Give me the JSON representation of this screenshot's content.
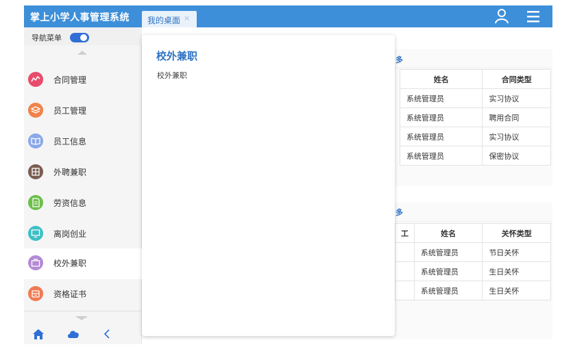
{
  "header": {
    "app_title": "掌上小学人事管理系统",
    "tab_label": "我的桌面",
    "tab_close": "×",
    "accent": "#3d8fd9"
  },
  "sidebar": {
    "toggle_label": "导航菜单",
    "toggle_on": true,
    "items": [
      {
        "label": "合同管理",
        "icon": "chart-line-icon",
        "color": "#e84c6a"
      },
      {
        "label": "员工管理",
        "icon": "layers-icon",
        "color": "#f0834b"
      },
      {
        "label": "员工信息",
        "icon": "book-icon",
        "color": "#8aa8e8"
      },
      {
        "label": "外聘兼职",
        "icon": "grid-icon",
        "color": "#7a5d52"
      },
      {
        "label": "劳资信息",
        "icon": "document-icon",
        "color": "#6cbf4a"
      },
      {
        "label": "离岗创业",
        "icon": "monitor-icon",
        "color": "#3cc0c6"
      },
      {
        "label": "校外兼职",
        "icon": "briefcase-icon",
        "color": "#b48ad6"
      },
      {
        "label": "资格证书",
        "icon": "archive-icon",
        "color": "#f07a52"
      }
    ],
    "active_index": 6,
    "bottom_icons": [
      "home-icon",
      "cloud-icon",
      "back-chevron-icon"
    ]
  },
  "content": {
    "panel1": {
      "more_label": "多",
      "columns": [
        "姓名",
        "合同类型"
      ],
      "rows": [
        [
          "系统管理员",
          "实习协议"
        ],
        [
          "系统管理员",
          "聘用合同"
        ],
        [
          "系统管理员",
          "实习协议"
        ],
        [
          "系统管理员",
          "保密协议"
        ]
      ]
    },
    "panel2": {
      "more_label": "多",
      "columns": [
        "工",
        "姓名",
        "关怀类型"
      ],
      "rows": [
        [
          "系统管理员",
          "节日关怀"
        ],
        [
          "系统管理员",
          "生日关怀"
        ],
        [
          "系统管理员",
          "生日关怀"
        ]
      ]
    }
  },
  "popup": {
    "title": "校外兼职",
    "body": "校外兼职"
  }
}
